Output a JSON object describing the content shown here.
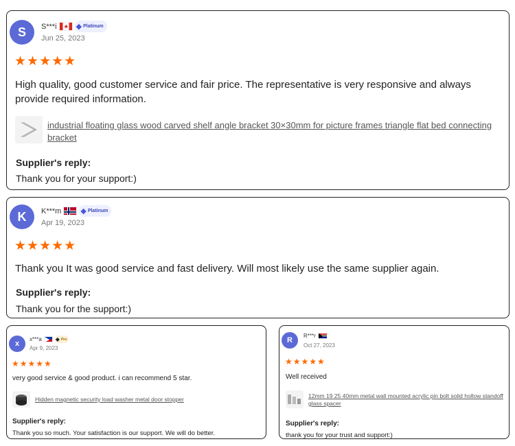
{
  "reviews": [
    {
      "avatar_letter": "S",
      "avatar_color": "#5b6ad6",
      "name": "S***i",
      "flag": "canada-flag",
      "badge": "Platinum",
      "date": "Jun 25, 2023",
      "stars": "★★★★★",
      "text": "High quality, good customer service and fair price. The representative is very responsive and always provide required information.",
      "product": "industrial floating glass wood carved shelf angle bracket 30×30mm for picture frames triangle flat bed connecting bracket",
      "reply_title": "Supplier's reply:",
      "reply_text": "Thank you for your support:)"
    },
    {
      "avatar_letter": "K",
      "avatar_color": "#5b6ad6",
      "name": "K***m",
      "flag": "norway-flag",
      "badge": "Platinum",
      "date": "Apr 19, 2023",
      "stars": "★★★★★",
      "text": "Thank you It was good service and fast delivery. Will most likely use the same supplier again.",
      "reply_title": "Supplier's reply:",
      "reply_text": "Thank you for the support:)"
    },
    {
      "avatar_letter": "x",
      "avatar_color": "#5b6ad6",
      "name": "x***a",
      "flag": "philippines-flag",
      "badge": "Pro",
      "date": "Apr 9, 2023",
      "stars": "★★★★★",
      "text": "very good service & good product. i can recommend 5 star.",
      "product": "Hidden magnetic security load washer metal door stopper",
      "reply_title": "Supplier's reply:",
      "reply_text": "Thank you so much. Your satisfaction is our support. We will do better."
    },
    {
      "avatar_letter": "R",
      "avatar_color": "#5b6ad6",
      "name": "R***r",
      "flag": "south-africa-flag",
      "date": "Oct 27, 2023",
      "stars": "★★★★★",
      "text": "Well received",
      "product": "12mm 19 25 40mm metal wall mounted acrylic pin bolt solid hollow standoff glass spacer",
      "reply_title": "Supplier's reply:",
      "reply_text": "thank you for your trust and support:)"
    }
  ],
  "colors": {
    "star": "#ff6a00",
    "avatar": "#5b6ad6",
    "border": "#222222"
  }
}
